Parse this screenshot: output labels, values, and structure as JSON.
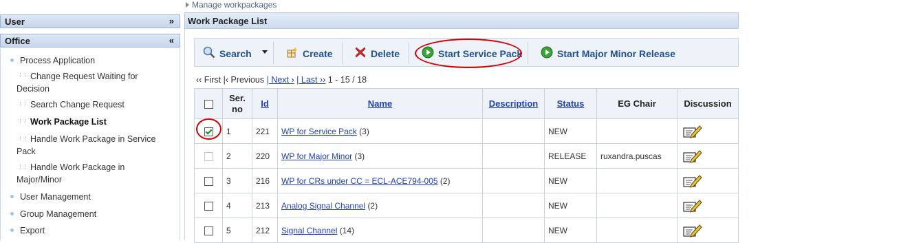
{
  "breadcrumb": {
    "label": "Manage workpackages"
  },
  "sidebar": {
    "user_panel": {
      "title": "User",
      "toggle": "»"
    },
    "office_panel": {
      "title": "Office",
      "toggle": "«"
    },
    "items": [
      {
        "label": "Process Application"
      },
      {
        "label": "Change Request Waiting for"
      },
      {
        "label": "Decision"
      },
      {
        "label": "Search Change Request"
      },
      {
        "label": "Work Package List"
      },
      {
        "label": "Handle Work Package in Service"
      },
      {
        "label": "Pack"
      },
      {
        "label": "Handle Work Package in"
      },
      {
        "label": "Major/Minor"
      },
      {
        "label": "User Management"
      },
      {
        "label": "Group Management"
      },
      {
        "label": "Export"
      }
    ]
  },
  "main": {
    "title": "Work Package List"
  },
  "toolbar": {
    "search": "Search",
    "create": "Create",
    "delete": "Delete",
    "start_service_pack": "Start Service Pack",
    "start_major_minor": "Start Major Minor Release"
  },
  "pager": {
    "first": "‹‹ First",
    "previous": "|‹ Previous",
    "next": "| Next ›",
    "last": "| Last ››",
    "range": "1 - 15 / 18"
  },
  "table": {
    "headers": {
      "serno_line1": "Ser.",
      "serno_line2": "no",
      "id": "Id",
      "name": "Name",
      "description": "Description",
      "status": "Status",
      "eg_chair": "EG Chair",
      "discussion": "Discussion"
    },
    "rows": [
      {
        "checked": true,
        "disabled": false,
        "serno": "1",
        "id": "221",
        "name": "WP for Service Pack",
        "count": "(3)",
        "description": "",
        "status": "NEW",
        "eg_chair": ""
      },
      {
        "checked": false,
        "disabled": true,
        "serno": "2",
        "id": "220",
        "name": "WP for Major Minor",
        "count": "(3)",
        "description": "",
        "status": "RELEASE",
        "eg_chair": "ruxandra.puscas"
      },
      {
        "checked": false,
        "disabled": false,
        "serno": "3",
        "id": "216",
        "name": "WP for CRs under CC = ECL-ACE794-005",
        "count": "(2)",
        "description": "",
        "status": "NEW",
        "eg_chair": ""
      },
      {
        "checked": false,
        "disabled": false,
        "serno": "4",
        "id": "213",
        "name": "Analog Signal Channel",
        "count": "(2)",
        "description": "",
        "status": "NEW",
        "eg_chair": ""
      },
      {
        "checked": false,
        "disabled": false,
        "serno": "5",
        "id": "212",
        "name": "Signal Channel",
        "count": "(14)",
        "description": "",
        "status": "NEW",
        "eg_chair": ""
      }
    ]
  },
  "colors": {
    "accent_blue": "#1f3fbf",
    "annotation_red": "#d40000",
    "panel_header": "#c6d6eb"
  },
  "icons": [
    "search-icon",
    "create-icon",
    "delete-icon",
    "play-icon",
    "discussion-edit-icon"
  ]
}
